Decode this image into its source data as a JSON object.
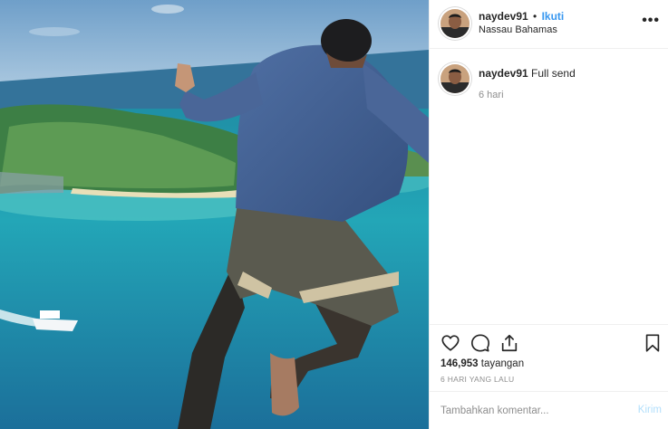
{
  "post": {
    "username": "naydev91",
    "separator": "•",
    "follow_label": "Ikuti",
    "location": "Nassau Bahamas",
    "more_label": "•••",
    "caption_text": "Full send",
    "caption_time": "6 hari",
    "views_count": "146,953",
    "views_label": "tayangan",
    "posted_ago": "6 HARI YANG LALU",
    "comment_placeholder": "Tambahkan komentar...",
    "post_label": "Kirim"
  },
  "icons": {
    "like": "heart-icon",
    "comment": "comment-icon",
    "share": "share-icon",
    "save": "bookmark-icon",
    "more": "more-options-icon"
  },
  "colors": {
    "link": "#3897f0",
    "muted": "#8e8e8e",
    "post_disabled": "#b2dffc",
    "border": "#efefef"
  }
}
